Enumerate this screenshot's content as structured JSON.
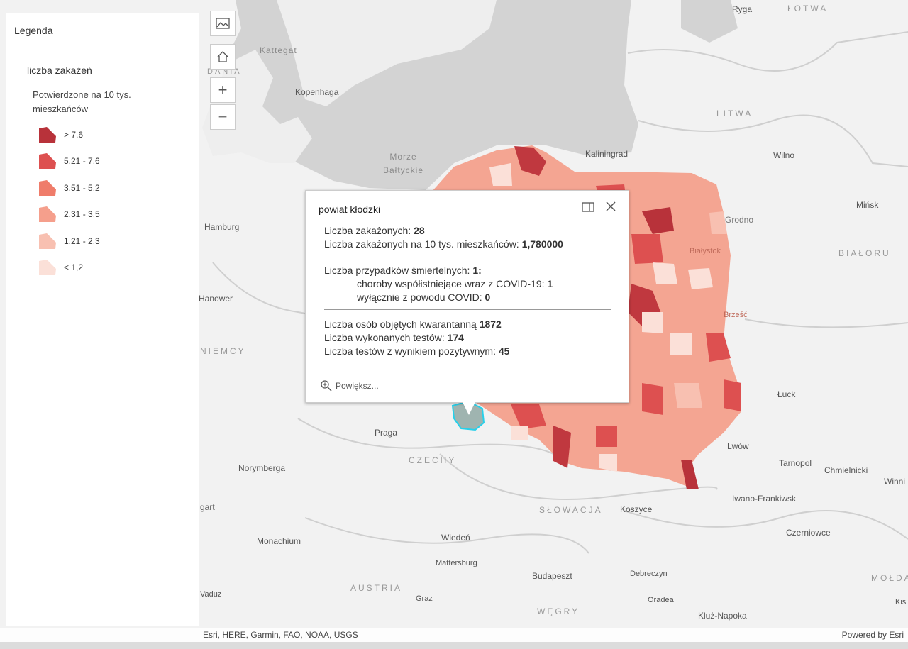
{
  "legend": {
    "title": "Legenda",
    "layer_name": "liczba zakażeń",
    "field_name": "Potwierdzone na 10 tys. mieszkańców",
    "classes": [
      {
        "label": "> 7,6",
        "color": "#b8323a"
      },
      {
        "label": "5,21 - 7,6",
        "color": "#dd5050"
      },
      {
        "label": "3,51 - 5,2",
        "color": "#ef7c6a"
      },
      {
        "label": "2,31 - 3,5",
        "color": "#f59f8c"
      },
      {
        "label": "1,21 - 2,3",
        "color": "#f8c0b1"
      },
      {
        "label": "< 1,2",
        "color": "#fbe0d8"
      }
    ]
  },
  "controls": {
    "basemap_icon": "basemap-gallery-icon",
    "home_icon": "home-icon",
    "zoom_in": "+",
    "zoom_out": "−"
  },
  "popup": {
    "title": "powiat kłodzki",
    "lines": [
      {
        "label": "Liczba zakażonych: ",
        "value": "28"
      },
      {
        "label": "Liczba zakażonych na 10 tys. mieszkańców: ",
        "value": "1,780000"
      },
      {
        "label": "Liczba przypadków śmiertelnych: ",
        "value": "1:"
      },
      {
        "label": "choroby współistniejące wraz z COVID-19: ",
        "value": "1"
      },
      {
        "label": "wyłącznie z powodu COVID: ",
        "value": "0"
      },
      {
        "label": "Liczba osób objętych kwarantanną ",
        "value": "1872"
      },
      {
        "label": "Liczba wykonanych testów: ",
        "value": "174"
      },
      {
        "label": "Liczba testów z wynikiem pozytywnym: ",
        "value": "45"
      }
    ],
    "zoom_label": "Powiększ..."
  },
  "map_labels": {
    "places": [
      "Ryga",
      "Kopenhaga",
      "Kaliningrad",
      "Wilno",
      "Hamburg",
      "Mińsk",
      "Grodno",
      "Hanower",
      "Białystok",
      "Brześć",
      "Łuck",
      "Praga",
      "Lwów",
      "Norymberga",
      "Tarnopol",
      "Chmielnicki",
      "Winni",
      "gart",
      "Iwano-Frankiwsk",
      "Koszyce",
      "Czerniowce",
      "Monachium",
      "Wiedeń",
      "Mattersburg",
      "Budapeszt",
      "Debreczyn",
      "Graz",
      "Oradea",
      "Kluż-Napoka",
      "Vaduz",
      "Kis"
    ],
    "countries": [
      "ŁOTWA",
      "LITWA",
      "BIAŁORU",
      "NIEMCY",
      "CZECHY",
      "SŁOWACJA",
      "AUSTRIA",
      "WĘGRY",
      "MOŁDA",
      "DANIA"
    ],
    "waters": [
      "Kattegat",
      "Morze\nBałtyckie"
    ]
  },
  "attribution": {
    "left": "Esri, HERE, Garmin, FAO, NOAA, USGS",
    "right": "Powered by Esri"
  }
}
